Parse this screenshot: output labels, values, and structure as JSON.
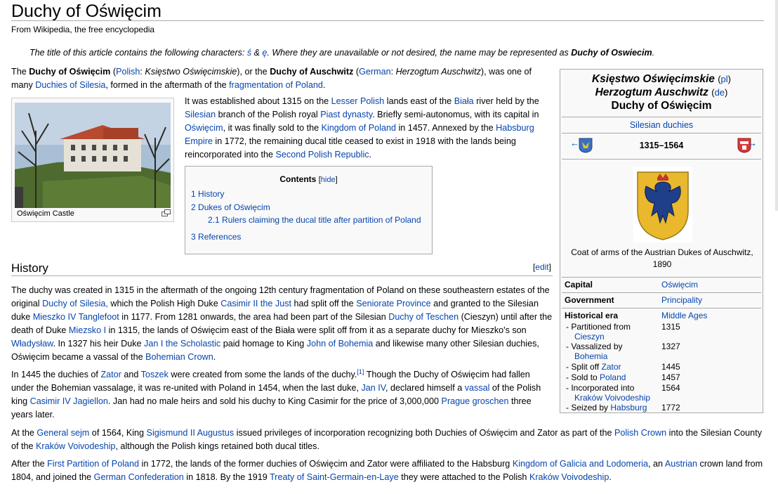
{
  "page": {
    "title": "Duchy of Oświęcim",
    "tagline": "From Wikipedia, the free encyclopedia",
    "notice": {
      "pre": "The title of this article contains the following characters: ",
      "ch1": "ś",
      "amp": " & ",
      "ch2": "ę",
      "mid": ". Where they are unavailable or not desired, the name may be represented as ",
      "alt": "Duchy of Oswiecim",
      "end": "."
    }
  },
  "lead": {
    "t1": "The ",
    "b1": "Duchy of Oświęcim",
    "t2": " (",
    "l_polish": "Polish",
    "t3": ": ",
    "i1": "Księstwo Oświęcimskie",
    "t4": "), or the ",
    "b2": "Duchy of Auschwitz",
    "t5": " (",
    "l_german": "German",
    "t6": ": ",
    "i2": "Herzogtum Auschwitz",
    "t7": "), was one of many ",
    "l_duchies": "Duchies of Silesia",
    "t8": ", formed in the aftermath of the ",
    "l_frag": "fragmentation of Poland",
    "t9": "."
  },
  "thumb": {
    "caption": "Oświęcim Castle"
  },
  "intro2": {
    "t1": "It was established about 1315 on the ",
    "l1": "Lesser Polish",
    "t2": " lands east of the ",
    "l2": "Biała",
    "t3": " river held by the ",
    "l3": "Silesian",
    "t4": " branch of the Polish royal ",
    "l4": "Piast dynasty",
    "t5": ". Briefly semi-autonomus, with its capital in ",
    "l5": "Oświęcim",
    "t6": ", it was finally sold to the ",
    "l6": "Kingdom of Poland",
    "t7": " in 1457. Annexed by the ",
    "l7": "Habsburg Empire",
    "t8": " in 1772, the remaining ducal title ceased to exist in 1918 with the lands being reincorporated into the ",
    "l8": "Second Polish Republic",
    "t9": "."
  },
  "toc": {
    "title": "Contents",
    "hide": "hide",
    "items": [
      {
        "num": "1",
        "label": "History"
      },
      {
        "num": "2",
        "label": "Dukes of Oświęcim"
      },
      {
        "num": "2.1",
        "label": "Rulers claiming the ducal title after partition of Poland"
      },
      {
        "num": "3",
        "label": "References"
      }
    ]
  },
  "infobox": {
    "name_pl": "Księstwo Oświęcimskie",
    "lang_pl": "pl",
    "name_de": "Herzogtum Auschwitz",
    "lang_de": "de",
    "name_en": "Duchy of Oświęcim",
    "duchies": "Silesian duchies",
    "years": "1315–1564",
    "arrow_left": "←",
    "arrow_right": "→",
    "coa_caption": "Coat of arms of the Austrian Dukes of Auschwitz, 1890",
    "capital_label": "Capital",
    "capital_value": "Oświęcim",
    "government_label": "Government",
    "government_value": "Principality",
    "era_label": "Historical era",
    "era_value": "Middle Ages",
    "events": [
      {
        "pre": "Partitioned from",
        "link": "Cieszyn",
        "year": "1315"
      },
      {
        "pre": "Vassalized by",
        "link": "Bohemia",
        "year": "1327"
      },
      {
        "pre": "Split off",
        "link": "Zator",
        "year": "1445"
      },
      {
        "pre": "Sold to",
        "link": "Poland",
        "year": "1457"
      },
      {
        "pre": "Incorporated into",
        "link": "Kraków Voivodeship",
        "year": "1564"
      },
      {
        "pre": "Seized by",
        "link": "Habsburg",
        "year": "1772"
      }
    ]
  },
  "history": {
    "heading": "History",
    "edit": "edit",
    "p1": {
      "t1": "The duchy was created in 1315 in the aftermath of the ongoing 12th century fragmentation of Poland on these southeastern estates of the original ",
      "l1": "Duchy of Silesia,",
      "t2": " which the Polish High Duke ",
      "l2": "Casimir II the Just",
      "t3": " had split off the ",
      "l3": "Seniorate Province",
      "t4": " and granted to the Silesian duke ",
      "l4": "Mieszko IV Tanglefoot",
      "t5": " in 1177. From 1281 onwards, the area had been part of the Silesian ",
      "l5": "Duchy of Teschen",
      "t6": " (Cieszyn) until after the death of Duke ",
      "l6": "Miezsko I",
      "t7": " in 1315, the lands of Oświęcim east of the Biała were split off from it as a separate duchy for Mieszko's son ",
      "l7": "Władysław",
      "t8": ". In 1327 his heir Duke ",
      "l8": "Jan I the Scholastic",
      "t9": " paid homage to King ",
      "l9": "John of Bohemia",
      "t10": " and likewise many other Silesian duchies, Oświęcim became a vassal of the ",
      "l10": "Bohemian Crown",
      "t11": "."
    },
    "p2": {
      "t1": "In 1445 the duchies of ",
      "l1": "Zator",
      "t2": " and ",
      "l2": "Toszek",
      "t3": " were created from some the lands of the duchy.",
      "ref": "[1]",
      "t4": " Though the Duchy of Oświęcim had fallen under the Bohemian vassalage, it was re-united with Poland in 1454, when the last duke, ",
      "l3": "Jan IV",
      "t5": ", declared himself a ",
      "l4": "vassal",
      "t6": " of the Polish king ",
      "l5": "Casimir IV Jagiellon",
      "t7": ". Jan had no male heirs and sold his duchy to King Casimir for the price of 3,000,000 ",
      "l6": "Prague groschen",
      "t8": " three years later."
    },
    "p3": {
      "t1": "At the ",
      "l1": "General sejm",
      "t2": " of 1564, King ",
      "l2": "Sigismund II Augustus",
      "t3": " issued privileges of incorporation recognizing both Duchies of Oświęcim and Zator as part of the ",
      "l3": "Polish Crown",
      "t4": " into the Silesian County of the ",
      "l4": "Kraków Voivodeship",
      "t5": ", although the Polish kings retained both ducal titles."
    },
    "p4": {
      "t1": "After the ",
      "l1": "First Partition of Poland",
      "t2": " in 1772, the lands of the former duchies of Oświęcim and Zator were affiliated to the Habsburg ",
      "l2": "Kingdom of Galicia and Lodomeria",
      "t3": ", an ",
      "l3": "Austrian",
      "t4": " crown land from 1804, and joined the ",
      "l4": "German Confederation",
      "t5": " in 1818. By the 1919 ",
      "l5": "Treaty of Saint-Germain-en-Laye",
      "t6": " they were attached to the Polish ",
      "l6": "Kraków Voivodeship",
      "t7": "."
    }
  }
}
